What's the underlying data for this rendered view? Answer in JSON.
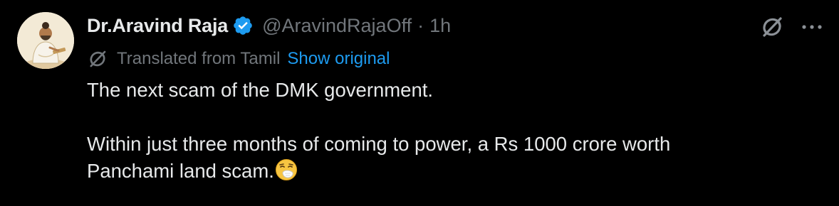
{
  "author": {
    "display_name": "Dr.Aravind Raja",
    "handle": "@AravindRajaOff",
    "separator": "·",
    "time": "1h",
    "verified_color": "#1d9bf0"
  },
  "translation": {
    "label": "Translated from Tamil",
    "show_original": "Show original"
  },
  "tweet": {
    "line1": "The next scam of the DMK government.",
    "line2": "Within just three months of coming to power, a Rs 1000 crore worth",
    "line3": "Panchami land scam.",
    "emoji": "sneezing-face-emoji"
  },
  "icons": {
    "grok": "grok-icon",
    "more": "more-dots-icon",
    "translate": "translate-icon",
    "verified": "verified-badge-icon"
  },
  "colors": {
    "background": "#000000",
    "text_primary": "#e7e9ea",
    "text_secondary": "#71767b",
    "link": "#1d9bf0"
  }
}
